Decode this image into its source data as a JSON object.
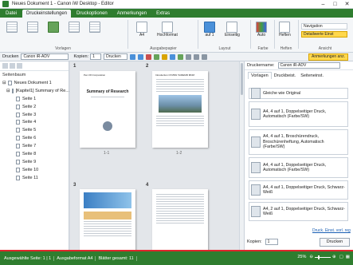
{
  "window": {
    "title": "Neues Dokument 1 - Canon iW Desktop - Editor",
    "controls": [
      "minimize-icon",
      "maximize-icon",
      "close-icon"
    ]
  },
  "tabs": [
    {
      "label": "Datei",
      "active": false
    },
    {
      "label": "Druckeinstellungen",
      "active": true
    },
    {
      "label": "Druckoptionen",
      "active": false
    },
    {
      "label": "Anmerkungen",
      "active": false
    },
    {
      "label": "Extras",
      "active": false
    }
  ],
  "ribbon": {
    "groups": {
      "vorlagen": "Vorlagen",
      "ausgabepapier": "Ausgabepapier",
      "layout": "Layout",
      "farbe": "Farbe",
      "heften": "Heften",
      "ansicht": "Ansicht"
    },
    "buttons": {
      "a4": "A4",
      "hochformat": "Hochformat",
      "auf1": "auf 1",
      "einseitig": "Einseitig",
      "auto": "Auto",
      "heften": "Heften",
      "navigation": "Navigation",
      "detailwerte": "Detailwerte Einst"
    }
  },
  "toolbar": {
    "printer_label": "Drucken",
    "printer_value": "Canon iR-ADV",
    "kopien_label": "Kopien:",
    "kopien_value": "1",
    "print_button": "Drucken",
    "annotations": "Anmerkungen anz."
  },
  "left_panel": {
    "header": "Seitenbaum",
    "root": "Neues Dokument 1",
    "chapter": "[Kapitel1] Summary of Re...",
    "pages": [
      "Seite 1",
      "Seite 2",
      "Seite 3",
      "Seite 4",
      "Seite 5",
      "Seite 6",
      "Seite 7",
      "Seite 8",
      "Seite 9",
      "Seite 10",
      "Seite 11"
    ]
  },
  "canvas": {
    "page_numbers": [
      "1",
      "2",
      "3",
      "4"
    ],
    "page_labels": [
      "1-1",
      "1-2"
    ],
    "page1_title": "Summary of Research",
    "page1_header": "Pen ON Corporation",
    "page2_header": "Introduction Of MNN To/REMR MNM"
  },
  "right_panel": {
    "printer_label": "Druckername:",
    "printer_value": "Canon iR-ADV",
    "tabs": [
      {
        "label": "Vorlagen",
        "active": true
      },
      {
        "label": "Druckbeist.",
        "active": false
      },
      {
        "label": "Seiteneinst.",
        "active": false
      }
    ],
    "presets": [
      "Gleiche wie Original",
      "A4, 4 auf 1, Doppelseitiger Druck, Automatisch (Farbe/SW)",
      "A4, 4 auf 1, Broschürendruck, Broschürenheftung, Automatisch (Farbe/SW)",
      "A4, 4 auf 1, Doppelseitiger Druck, Automatisch (Farbe/SW)",
      "A4, 4 auf 1, Doppelseitiger Druck, Schwarz-Weiß",
      "A4, 2 auf 1, Doppelseitiger Druck, Schwarz-Weiß"
    ],
    "link": "Druck. Einst. vorl. reg",
    "kopien_label": "Kopien:",
    "kopien_value": "1",
    "print_button": "Drucken"
  },
  "statusbar": {
    "selected": "Ausgewählte Seite: 1 | 1",
    "format": "Ausgabeformat A4",
    "total": "Blätter gesamt: 11",
    "zoom": "25%"
  },
  "colors": {
    "accent_green": "#2f7d2f",
    "status_border": "#e0262c",
    "highlight": "#ffd84d"
  }
}
